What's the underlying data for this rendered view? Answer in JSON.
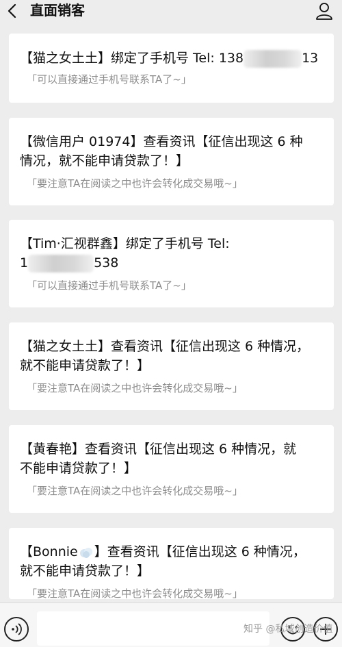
{
  "header": {
    "title": "直面销客"
  },
  "cards": [
    {
      "main_before": "【猫之女土土】绑定了手机号 Tel: 138",
      "main_after": "13",
      "sub": "「可以直接通过手机号联系TA了~」"
    },
    {
      "main_line1": "【微信用户 01974】查看资讯【征信出现这 6 种",
      "main_line2": "情况，就不能申请贷款了！】",
      "sub": "「要注意TA在阅读之中也许会转化成交易哦~」"
    },
    {
      "main_line1": "【Tim·汇视群鑫】绑定了手机号 Tel:",
      "main_before": "1",
      "main_after": "538",
      "sub": "「可以直接通过手机号联系TA了~」"
    },
    {
      "main_line1": "【猫之女土土】查看资讯【征信出现这 6 种情况，",
      "main_line2": "就不能申请贷款了！】",
      "sub": "「要注意TA在阅读之中也许会转化成交易哦~」"
    },
    {
      "main_line1": "【黄春艳】查看资讯【征信出现这 6 种情况，就",
      "main_line2": "不能申请贷款了！】",
      "sub": "「要注意TA在阅读之中也许会转化成交易哦~」"
    },
    {
      "main_line1_a": "【Bonnie",
      "main_line1_b": "】查看资讯【征信出现这 6 种情况，",
      "main_line2": "就不能申请贷款了！】",
      "sub": "「要注意TA在阅读之中也许会转化成交易哦~」"
    }
  ],
  "footer": {
    "watermark": "知乎 @私域创造价值"
  },
  "icons": {
    "back": "chevron-left-icon",
    "profile": "person-icon",
    "voice": "voice-icon",
    "emoji": "emoji-icon",
    "plus": "plus-icon"
  }
}
